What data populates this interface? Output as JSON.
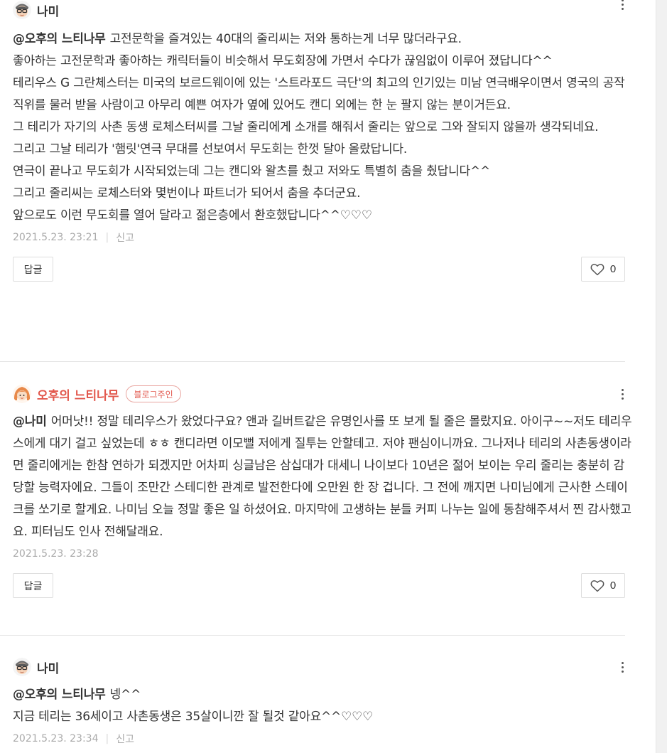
{
  "comments": [
    {
      "author": "나미",
      "mention": "@오후의 느티나무",
      "text": "고전문학을 즐겨있는 40대의 줄리씨는 저와 통하는게 너무 많더라구요.\n좋아하는 고전문학과 좋아하는 캐릭터들이 비슷해서 무도회장에 가면서 수다가 끊임없이 이루어 졌답니다^^\n테리우스 G 그란체스터는 미국의 보르드웨이에 있는 '스트라포드 극단'의 최고의 인기있는 미남 연극배우이면서 영국의 공작직위를 물러 받을 사람이고 아무리 예쁜 여자가 옆에 있어도 캔디 외에는 한 눈 팔지 않는 분이거든요.\n그 테리가 자기의 사촌 동생 로체스터씨를 그날 줄리에게 소개를 해줘서 줄리는 앞으로 그와 잘되지 않을까 생각되네요.\n그리고 그날 테리가 '햄릿'연극 무대를 선보여서 무도회는 한껏 달아 올랐답니다.\n연극이 끝나고 무도회가 시작되었는데 그는 캔디와 왈츠를 췄고 저와도 특별히 춤을 췄답니다^^\n그리고 줄리씨는 로체스터와 몇번이나 파트너가 되어서 춤을 추더군요.\n앞으로도 이런 무도회를 열어 달라고 젊은층에서 환호했답니다^^♡♡♡",
      "timestamp": "2021.5.23. 23:21",
      "report_label": "신고",
      "reply_label": "답글",
      "likes": "0"
    },
    {
      "author": "오후의 느티나무",
      "badge": "블로그주인",
      "mention": "@나미",
      "text": "어머낫!! 정말 테리우스가 왔었다구요? 앤과 길버트같은 유명인사를 또 보게 될 줄은 몰랐지요. 아이구~~저도 테리우스에게 대기 걸고 싶었는데 ㅎㅎ 캔디라면 이모뻘 저에게 질투는 안할테고. 저야 팬심이니까요. 그나저나 테리의 사촌동생이라면 줄리에게는 한참 연하가 되겠지만 어차피 싱글남은 삼십대가 대세니 나이보다 10년은 젊어 보이는 우리 줄리는 충분히 감당할 능력자에요. 그들이 조만간 스테디한 관계로 발전한다에 오만원 한 장 겁니다. 그 전에 깨지면 나미님에게 근사한 스테이크를 쏘기로 할게요. 나미님 오늘 정말 좋은 일 하셨어요. 마지막에 고생하는 분들 커피 나누는 일에 동참해주셔서 찐 감사했고요. 피터님도 인사 전해달래요.",
      "timestamp": "2021.5.23. 23:28",
      "reply_label": "답글",
      "likes": "0"
    },
    {
      "author": "나미",
      "mention": "@오후의 느티나무",
      "text": "넹^^\n지금 테리는 36세이고 사촌동생은 35살이니깐 잘 될것 같아요^^♡♡♡",
      "timestamp": "2021.5.23. 23:34",
      "report_label": "신고"
    }
  ],
  "icons": {
    "more": "more-vertical-icon",
    "like": "heart-outline-icon",
    "avatar_nami": "glasses-avatar-icon",
    "avatar_owner": "orange-hair-avatar-icon"
  },
  "colors": {
    "owner_name": "#e2574c",
    "meta_text": "#aaaaaa",
    "border": "#dddddd"
  }
}
